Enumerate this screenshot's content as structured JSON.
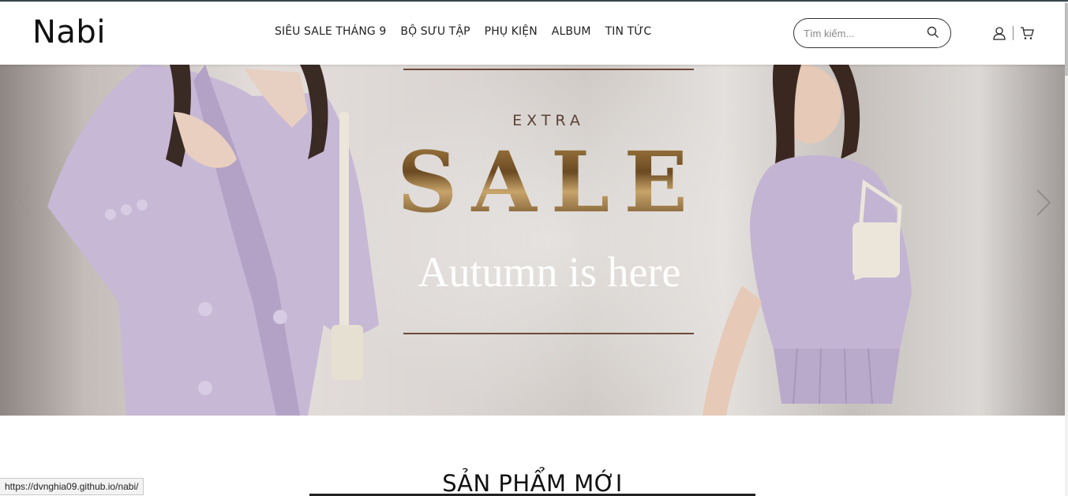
{
  "header": {
    "logo": "Nabi",
    "nav": [
      {
        "label": "SIÊU SALE THÁNG 9"
      },
      {
        "label": "BỘ SƯU TẬP"
      },
      {
        "label": "PHỤ KIỆN"
      },
      {
        "label": "ALBUM"
      },
      {
        "label": "TIN TỨC"
      }
    ],
    "search": {
      "placeholder": "Tìm kiếm...",
      "value": "",
      "icon": "search-icon"
    },
    "icons": [
      "user-icon",
      "cart-icon"
    ]
  },
  "hero": {
    "extra": "EXTRA",
    "sale": "SALE",
    "tagline": "Autumn is here",
    "prev_icon": "chevron-left-icon",
    "next_icon": "chevron-right-icon",
    "accent_color": "#8b6a3a",
    "jacket_color": "#c9bcd6"
  },
  "section": {
    "title": "SẢN PHẨM MỚI"
  },
  "status_bar": {
    "url": "https://dvnghia09.github.io/nabi/"
  }
}
